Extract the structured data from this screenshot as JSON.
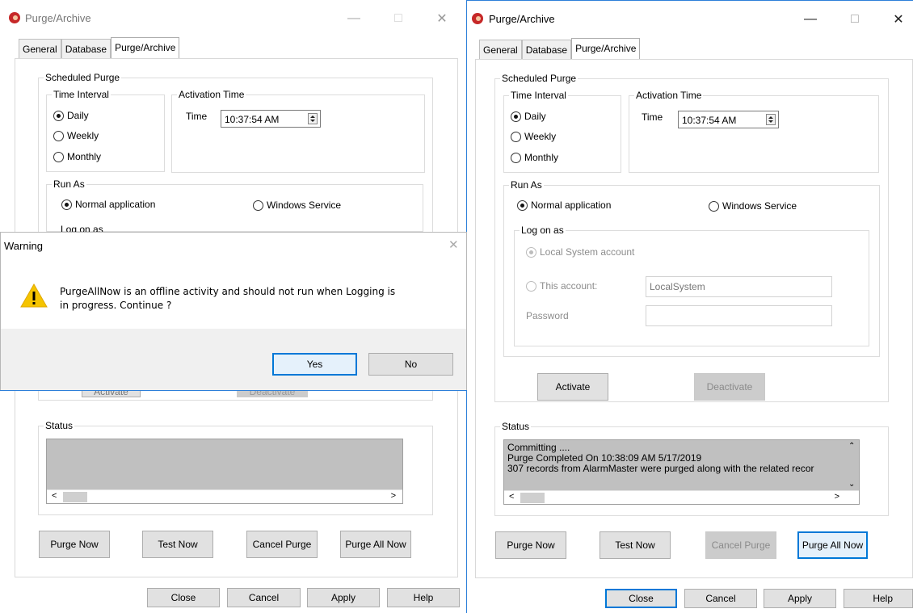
{
  "left_window": {
    "title": "Purge/Archive",
    "tabs": [
      "General",
      "Database",
      "Purge/Archive"
    ],
    "scheduled_purge": "Scheduled Purge",
    "time_interval": "Time Interval",
    "daily": "Daily",
    "weekly": "Weekly",
    "monthly": "Monthly",
    "activation_time": "Activation Time",
    "time_label": "Time",
    "time_value": "10:37:54 AM",
    "run_as": "Run As",
    "normal_application": "Normal application",
    "windows_service": "Windows Service",
    "log_on_as_partial": "Log on as",
    "activate_partial": "Activate",
    "deactivate_partial": "Deactivate",
    "status": "Status",
    "buttons": {
      "purge_now": "Purge Now",
      "test_now": "Test Now",
      "cancel_purge": "Cancel Purge",
      "purge_all_now": "Purge All Now",
      "close": "Close",
      "cancel": "Cancel",
      "apply": "Apply",
      "help": "Help"
    }
  },
  "warning_dialog": {
    "title": "Warning",
    "message_line1": "PurgeAllNow is an offline activity and should not run when Logging is",
    "message_line2": "in progress. Continue ?",
    "yes": "Yes",
    "no": "No"
  },
  "right_window": {
    "title": "Purge/Archive",
    "tabs": [
      "General",
      "Database",
      "Purge/Archive"
    ],
    "scheduled_purge": "Scheduled Purge",
    "time_interval": "Time Interval",
    "daily": "Daily",
    "weekly": "Weekly",
    "monthly": "Monthly",
    "activation_time": "Activation Time",
    "time_label": "Time",
    "time_value": "10:37:54 AM",
    "run_as": "Run As",
    "normal_application": "Normal application",
    "windows_service": "Windows Service",
    "log_on_as": "Log on as",
    "local_system_account": "Local System account",
    "this_account": "This account:",
    "account_value": "LocalSystem",
    "password": "Password",
    "activate": "Activate",
    "deactivate": "Deactivate",
    "status": "Status",
    "status_lines": [
      "Committing ....",
      "Purge Completed On  10:38:09 AM 5/17/2019",
      "307 records from AlarmMaster were purged along with the  related recor"
    ],
    "buttons": {
      "purge_now": "Purge Now",
      "test_now": "Test Now",
      "cancel_purge": "Cancel Purge",
      "purge_all_now": "Purge All Now",
      "close": "Close",
      "cancel": "Cancel",
      "apply": "Apply",
      "help": "Help"
    }
  },
  "colors": {
    "accent": "#0078d7",
    "disabled_button": "#cccccc",
    "status_bg": "#c0c0c0",
    "warning_yellow": "#f5c400"
  }
}
